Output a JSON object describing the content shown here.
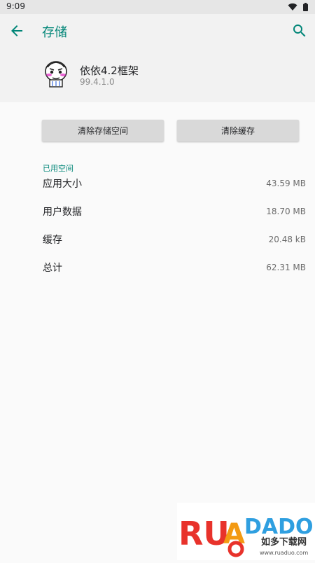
{
  "status_bar": {
    "time": "9:09"
  },
  "toolbar": {
    "title": "存储",
    "back_icon": "arrow-back-icon",
    "search_icon": "search-icon"
  },
  "app": {
    "name": "依依4.2框架",
    "version": "99.4.1.0"
  },
  "buttons": {
    "clear_storage": "清除存储空间",
    "clear_cache": "清除缓存"
  },
  "storage": {
    "section_title": "已用空间",
    "rows": [
      {
        "label": "应用大小",
        "value": "43.59 MB"
      },
      {
        "label": "用户数据",
        "value": "18.70 MB"
      },
      {
        "label": "缓存",
        "value": "20.48 kB"
      },
      {
        "label": "总计",
        "value": "62.31 MB"
      }
    ]
  },
  "watermark": {
    "logo_text": "RUANDADO",
    "subtitle": "如多下载网",
    "url": "www.ruaduo.com"
  },
  "colors": {
    "accent": "#008577",
    "toolbar_bg": "#f2f2f2",
    "button_bg": "#d9d9d9"
  }
}
